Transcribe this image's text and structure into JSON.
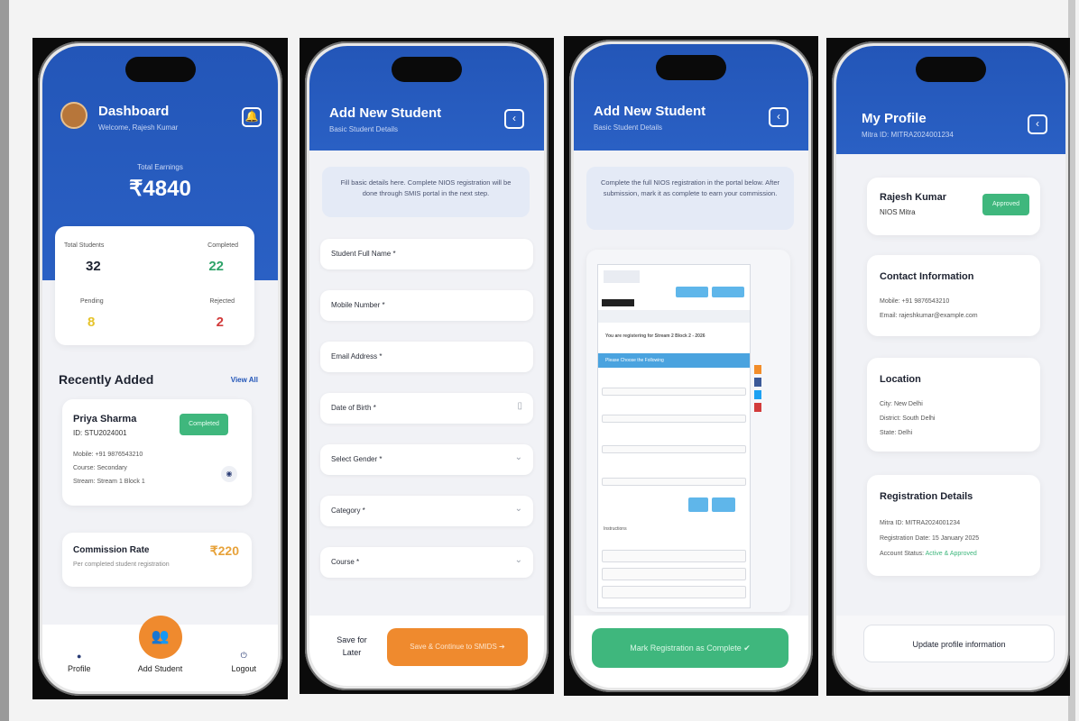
{
  "screen1": {
    "title": "Dashboard",
    "welcome": "Welcome, Rajesh Kumar",
    "earnings_label": "Total Earnings",
    "earnings_value": "₹4840",
    "stats": [
      {
        "label": "Total Students",
        "value": "32",
        "color": "#1d2230"
      },
      {
        "label": "Completed",
        "value": "22",
        "color": "#2fa36a"
      },
      {
        "label": "Pending",
        "value": "8",
        "color": "#e6c32a"
      },
      {
        "label": "Rejected",
        "value": "2",
        "color": "#d23b3b"
      }
    ],
    "recent_title": "Recently Added",
    "view_all": "View All",
    "student": {
      "name": "Priya Sharma",
      "id": "ID: STU2024001",
      "status": "Completed",
      "mobile": "Mobile: +91 9876543210",
      "course": "Course: Secondary",
      "stream": "Stream: Stream 1 Block 1"
    },
    "commission_title": "Commission Rate",
    "commission_value": "₹220",
    "commission_desc": "Per completed student registration",
    "nav": {
      "profile": "Profile",
      "add": "Add Student",
      "logout": "Logout"
    }
  },
  "screen2": {
    "title": "Add New Student",
    "subtitle": "Basic Student Details",
    "info": "Fill basic details here. Complete NIOS registration will be done through SMIS portal in the next step.",
    "fields": [
      {
        "label": "Student Full Name *",
        "icon": ""
      },
      {
        "label": "Mobile Number *",
        "icon": ""
      },
      {
        "label": "Email Address *",
        "icon": ""
      },
      {
        "label": "Date of Birth *",
        "icon": "▯"
      },
      {
        "label": "Select Gender *",
        "icon": "⌄"
      },
      {
        "label": "Category *",
        "icon": "⌄"
      },
      {
        "label": "Course *",
        "icon": "⌄"
      }
    ],
    "save_later": "Save for Later",
    "save_continue": "Save & Continue to SMIDS ➔"
  },
  "screen3": {
    "title": "Add New Student",
    "subtitle": "Basic Student Details",
    "info": "Complete the full NIOS registration in the portal below. After submission, mark it as complete to earn your commission.",
    "portal_heading": "You are registering for Stream 2 Block 2 - 2026",
    "portal_section": "Please Choose the Following",
    "portal_instructions": "Instructions",
    "mark_complete": "Mark Registration as Complete ✔"
  },
  "screen4": {
    "title": "My Profile",
    "subtitle": "Mitra ID: MITRA2024001234",
    "name": "Rajesh Kumar",
    "role": "NIOS Mitra",
    "status": "Approved",
    "contact_title": "Contact Information",
    "mobile": "Mobile: +91 9876543210",
    "email": "Email: rajeshkumar@example.com",
    "location_title": "Location",
    "city": "City: New Delhi",
    "district": "District: South Delhi",
    "state": "State: Delhi",
    "reg_title": "Registration Details",
    "mitra_id": "Mitra ID: MITRA2024001234",
    "reg_date": "Registration Date: 15 January 2025",
    "account_status_label": "Account Status: ",
    "account_status_value": "Active & Approved",
    "update_btn": "Update profile information"
  }
}
